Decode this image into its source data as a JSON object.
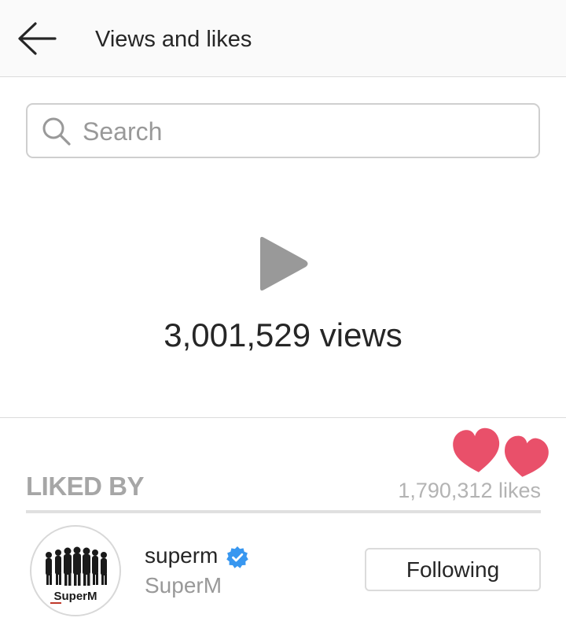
{
  "header": {
    "title": "Views and likes",
    "back_icon": "arrow-left-icon"
  },
  "search": {
    "placeholder": "Search",
    "value": "",
    "icon": "search-icon"
  },
  "video": {
    "icon": "play-icon",
    "views": "3,001,529 views"
  },
  "likes": {
    "section_title": "LIKED BY",
    "count": "1,790,312 likes",
    "heart_color": "#e9506a"
  },
  "liked_users": [
    {
      "username": "superm",
      "full_name": "SuperM",
      "verified": true,
      "avatar_text": "SuperM",
      "follow_label": "Following"
    }
  ],
  "colors": {
    "verified_blue": "#3897f0",
    "header_bg": "#fafafa",
    "divider": "#dbdbdb",
    "muted_text": "#999999",
    "play_gray": "#999999"
  }
}
